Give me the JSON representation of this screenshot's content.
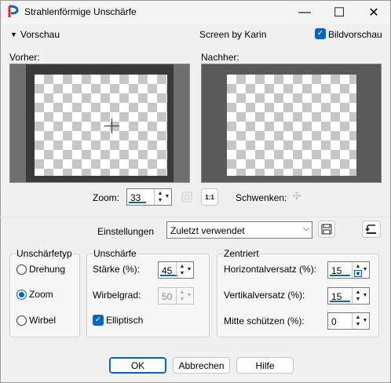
{
  "window": {
    "title": "Strahlenförmige Unschärfe",
    "minimize": "—",
    "maximize": "☐",
    "close": "✕"
  },
  "header": {
    "preview_toggle": "Vorschau",
    "credit": "Screen by Karin",
    "live_preview_label": "Bildvorschau",
    "live_preview_checked": true
  },
  "previews": {
    "before_label": "Vorher:",
    "after_label": "Nachher:"
  },
  "zoom": {
    "label": "Zoom:",
    "value": "33",
    "pan_label": "Schwenken:"
  },
  "settings": {
    "label": "Einstellungen",
    "selected": "Zuletzt verwendet"
  },
  "blur_type": {
    "title": "Unschärfetyp",
    "options": [
      {
        "label": "Drehung",
        "selected": false
      },
      {
        "label": "Zoom",
        "selected": true
      },
      {
        "label": "Wirbel",
        "selected": false
      }
    ]
  },
  "blur": {
    "title": "Unschärfe",
    "strength_label": "Stärke (%):",
    "strength_value": "45",
    "twist_label": "Wirbelgrad:",
    "twist_value": "50",
    "elliptical_label": "Elliptisch",
    "elliptical_checked": true
  },
  "centered": {
    "title": "Zentriert",
    "h_offset_label": "Horizontalversatz (%):",
    "h_offset_value": "15",
    "v_offset_label": "Vertikalversatz (%):",
    "v_offset_value": "15",
    "protect_center_label": "Mitte schützen (%):",
    "protect_center_value": "0"
  },
  "buttons": {
    "ok": "OK",
    "cancel": "Abbrechen",
    "help": "Hilfe"
  },
  "colors": {
    "accent": "#0067c0",
    "dialog_bg": "#f0f0f0",
    "preview_bg": "#6e6e6e"
  }
}
